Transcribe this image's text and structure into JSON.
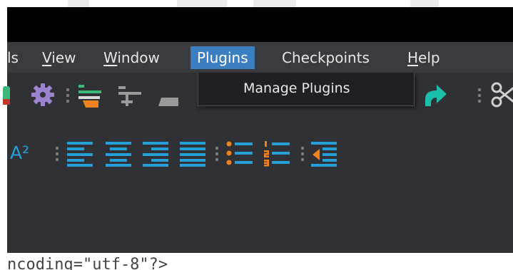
{
  "menubar": {
    "items": [
      {
        "id": "tools",
        "label": "ls",
        "underline": ""
      },
      {
        "id": "view",
        "label": "View",
        "underline": "V"
      },
      {
        "id": "window",
        "label": "Window",
        "underline": "W"
      },
      {
        "id": "plugins",
        "label": "Plugins",
        "underline": "",
        "active": true
      },
      {
        "id": "checkpoints",
        "label": "Checkpoints",
        "underline": ""
      },
      {
        "id": "help",
        "label": "Help",
        "underline": "H"
      }
    ]
  },
  "plugins_menu": {
    "items": [
      {
        "label": "Manage Plugins"
      }
    ]
  },
  "toolbar1": {
    "icons": [
      "green-partial-icon",
      "gear-icon",
      "align-left-highlight-icon",
      "align-right-gray-icon",
      "eraser-icon",
      "blue-stripes-icon",
      "yellow-partial-icon",
      "redo-icon",
      "scissors-icon"
    ]
  },
  "toolbar2": {
    "superscript_label": "A²",
    "icons": [
      "superscript-icon",
      "align-left-icon",
      "align-center-icon",
      "align-right-icon",
      "justify-icon",
      "bullet-list-icon",
      "numbered-list-icon",
      "outdent-icon"
    ]
  },
  "code_line": {
    "text": "ncoding=\"utf-8\"?>"
  },
  "colors": {
    "menubar_bg": "#3a3b3e",
    "toolbar_bg": "#303134",
    "active_menu": "#3c7fc0",
    "dropdown_bg": "#1f2023",
    "accent_blue": "#27a0da",
    "accent_teal": "#1bbfa9",
    "accent_orange": "#f0831e",
    "accent_purple": "#9b83cf"
  }
}
